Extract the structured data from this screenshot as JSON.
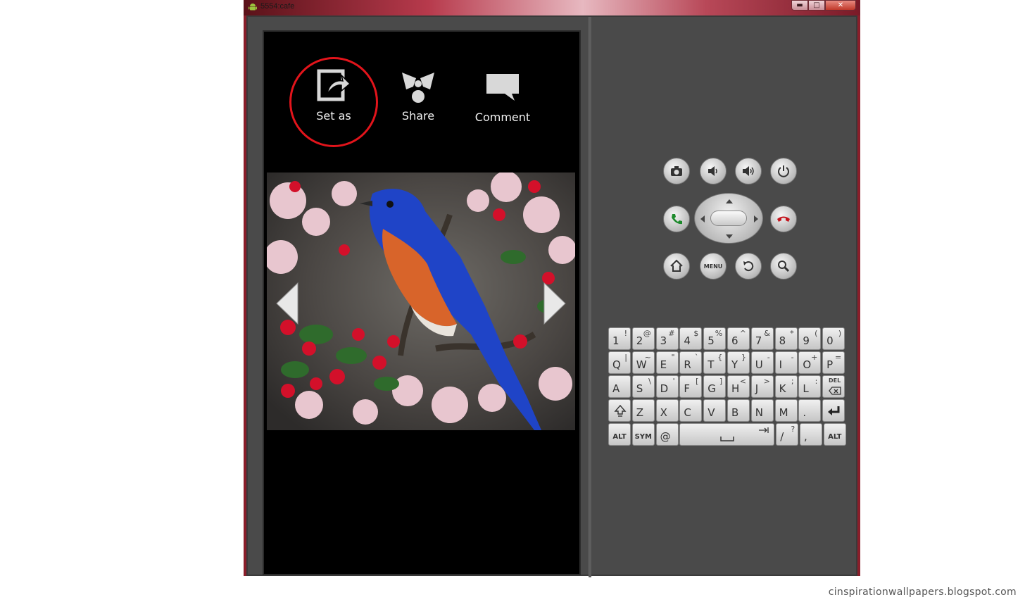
{
  "window": {
    "title": "5554:cafe",
    "controls": {
      "minimize": "▬",
      "maximize": "□",
      "close": "✕"
    }
  },
  "menu": {
    "items": [
      {
        "label": "Set as",
        "icon": "set-as-icon"
      },
      {
        "label": "Share",
        "icon": "share-icon"
      },
      {
        "label": "Comment",
        "icon": "comment-icon"
      }
    ]
  },
  "hardware": {
    "menu_label": "MENU"
  },
  "keyboard": {
    "row1": [
      [
        "1",
        "!"
      ],
      [
        "2",
        "@"
      ],
      [
        "3",
        "#"
      ],
      [
        "4",
        "$"
      ],
      [
        "5",
        "%"
      ],
      [
        "6",
        "^"
      ],
      [
        "7",
        "&"
      ],
      [
        "8",
        "*"
      ],
      [
        "9",
        "("
      ],
      [
        "0",
        ")"
      ]
    ],
    "row2": [
      [
        "Q",
        "|"
      ],
      [
        "W",
        "~"
      ],
      [
        "E",
        "\""
      ],
      [
        "R",
        "`"
      ],
      [
        "T",
        "{"
      ],
      [
        "Y",
        "}"
      ],
      [
        "U",
        "-"
      ],
      [
        "I",
        "-"
      ],
      [
        "O",
        "+"
      ],
      [
        "P",
        "="
      ]
    ],
    "row3": [
      [
        "A",
        ""
      ],
      [
        "S",
        "\\"
      ],
      [
        "D",
        "'"
      ],
      [
        "F",
        "["
      ],
      [
        "G",
        "]"
      ],
      [
        "H",
        "<"
      ],
      [
        "J",
        ">"
      ],
      [
        "K",
        ";"
      ],
      [
        "L",
        ":"
      ]
    ],
    "del_label": "DEL",
    "row4": [
      [
        "Z",
        ""
      ],
      [
        "X",
        ""
      ],
      [
        "C",
        ""
      ],
      [
        "V",
        ""
      ],
      [
        "B",
        ""
      ],
      [
        "N",
        ""
      ],
      [
        "M",
        ""
      ],
      [
        ".",
        ""
      ]
    ],
    "alt_label": "ALT",
    "sym_label": "SYM",
    "at_label": "@",
    "slash_key": [
      "/",
      "?"
    ],
    "comma_key": [
      ",",
      ""
    ]
  },
  "watermark": "cinspirationwallpapers.blogspot.com",
  "colors": {
    "highlight": "#e2141b",
    "screen": "#000000",
    "frame": "#4a4a4a"
  }
}
